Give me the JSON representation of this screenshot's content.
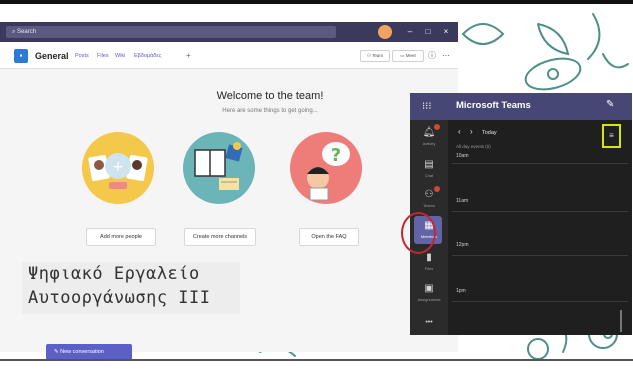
{
  "search": {
    "placeholder": "Search"
  },
  "window": {
    "minimize": "–",
    "maximize": "□",
    "close": "×"
  },
  "channel": {
    "name": "General",
    "tabs": [
      "Posts",
      "Files",
      "Wiki",
      "Εβδομάδες",
      "+"
    ],
    "team_button": "Team",
    "meet_button": "Meet",
    "info_icon": "ⓘ",
    "more_icon": "⋯"
  },
  "welcome": {
    "title": "Welcome to the team!",
    "subtitle": "Here are some things to get going...",
    "actions": [
      "Add more people",
      "Create more channels",
      "Open the FAQ"
    ]
  },
  "overlay": {
    "line1": "Ψηφιακό Εργαλείο",
    "line2": "Αυτοοργάνωσης III"
  },
  "compose": {
    "new_conversation": "New conversation"
  },
  "mobile": {
    "title": "Microsoft Teams",
    "nav": [
      "Activity",
      "Chat",
      "Teams",
      "Meetings",
      "Files",
      "Assignments"
    ],
    "more": "•••",
    "calendar": {
      "day": "Today",
      "all_day": "All day events (0)",
      "hours": [
        "10am",
        "11am",
        "12pm",
        "1pm"
      ]
    }
  },
  "colors": {
    "teams_purple": "#464775",
    "accent": "#5b5fc7",
    "highlight_red": "#c4262e",
    "highlight_yellow": "#d8e40c"
  }
}
